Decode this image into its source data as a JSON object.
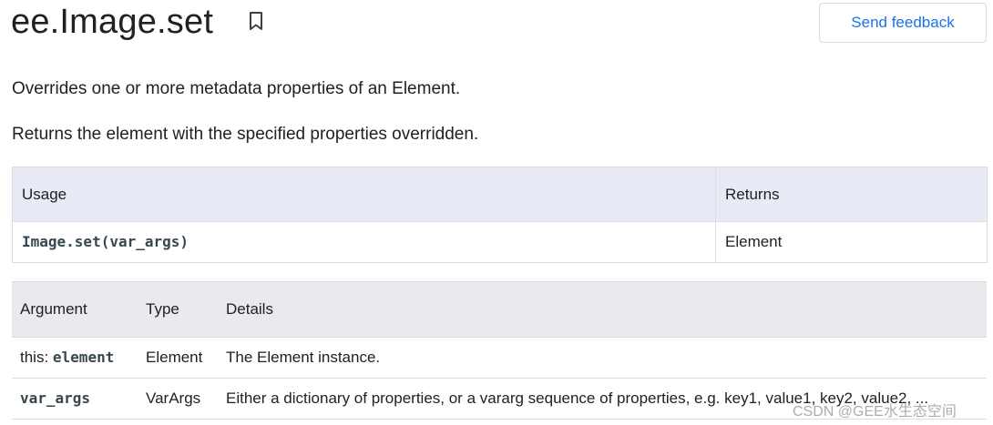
{
  "header": {
    "title": "ee.Image.set",
    "bookmark_icon": "bookmark-outline-icon",
    "feedback_label": "Send feedback"
  },
  "description": {
    "line1": "Overrides one or more metadata properties of an Element.",
    "line2": "Returns the element with the specified properties overridden."
  },
  "usage_table": {
    "headers": [
      "Usage",
      "Returns"
    ],
    "rows": [
      [
        "Image.set(var_args)",
        "Element"
      ]
    ]
  },
  "args_table": {
    "headers": [
      "Argument",
      "Type",
      "Details"
    ],
    "rows": [
      {
        "argument_prefix": "this: ",
        "argument_code": "element",
        "type": "Element",
        "details": "The Element instance."
      },
      {
        "argument_prefix": "",
        "argument_code": "var_args",
        "type": "VarArgs",
        "details": "Either a dictionary of properties, or a vararg sequence of properties, e.g. key1, value1, key2, value2, ..."
      }
    ]
  },
  "watermark": "CSDN @GEE水生态空间",
  "colors": {
    "accent": "#1a73e8",
    "usage_header_bg": "#e8eaf6",
    "args_header_bg": "#e8eaed",
    "border": "#dadce0"
  }
}
